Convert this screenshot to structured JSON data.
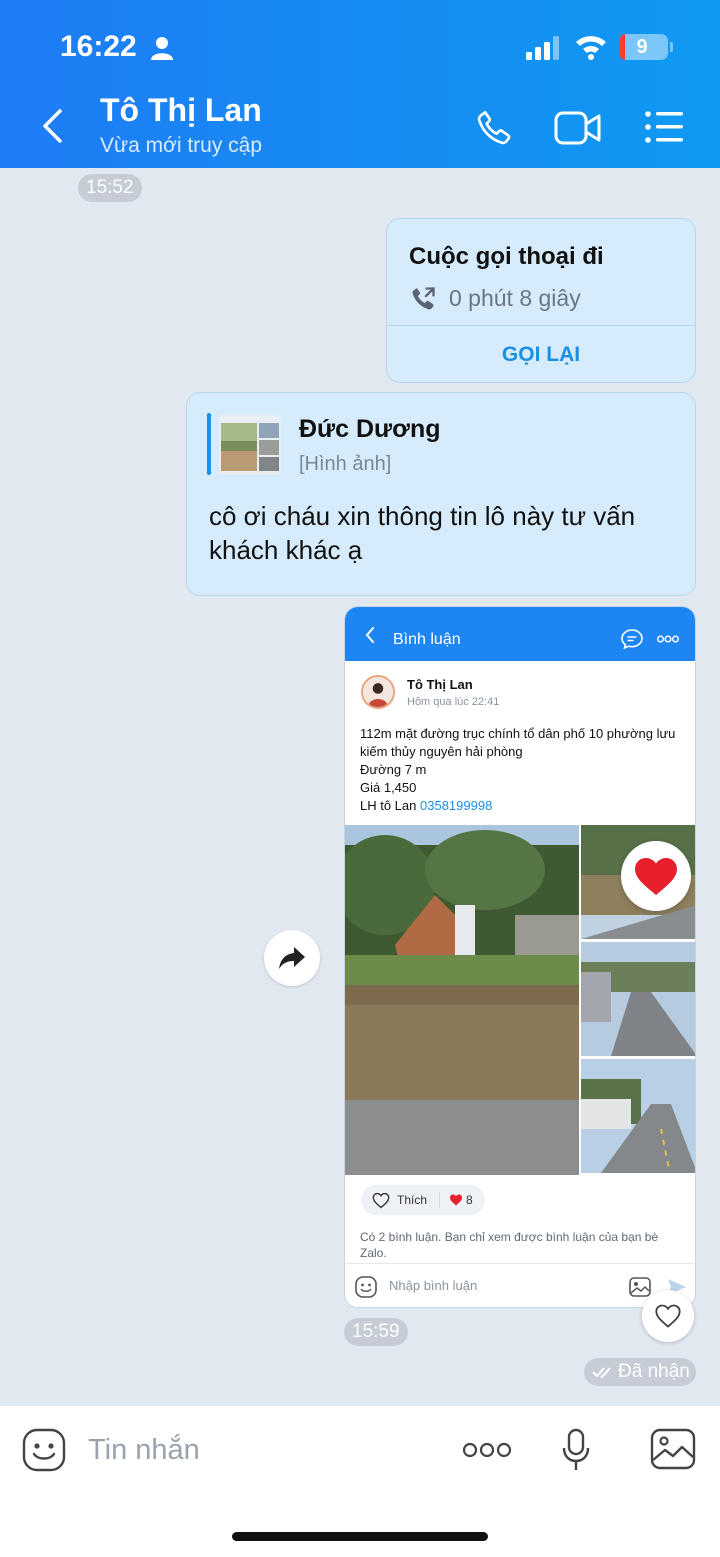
{
  "status_bar": {
    "time": "16:22",
    "battery": "9"
  },
  "header": {
    "contact_name": "Tô Thị Lan",
    "contact_status": "Vừa mới truy cập"
  },
  "chat": {
    "time_top": "15:52",
    "call": {
      "title": "Cuộc gọi thoại đi",
      "duration": "0 phút 8 giây",
      "action": "GỌI LẠI"
    },
    "quote": {
      "author": "Đức Dương",
      "type": "[Hình ảnh]",
      "message": "cô ơi cháu xin thông tin lô này tư vấn khách khác ạ"
    },
    "shared_post": {
      "topbar_title": "Bình luận",
      "author": "Tô Thị Lan",
      "time": "Hôm qua lúc 22:41",
      "body_lines": [
        "112m mặt đường trục chính tổ dân phố 10 phường lưu kiếm thủy nguyên hải phòng",
        "Đường 7 m",
        "Giá 1,450",
        "LH tô Lan "
      ],
      "phone": "0358199998",
      "like_label": "Thích",
      "heart_count": "8",
      "comment_note": "Có 2 bình luận. Bạn chỉ xem được bình luận của bạn bè Zalo.",
      "comment_placeholder": "Nhập bình luận"
    },
    "time_bottom": "15:59",
    "received": "Đã nhận"
  },
  "input_bar": {
    "placeholder": "Tin nhắn"
  },
  "colors": {
    "header": "#1e7cf5",
    "bubble": "#d6ecfc",
    "accent": "#1a8fe3",
    "heart": "#e8202e"
  }
}
